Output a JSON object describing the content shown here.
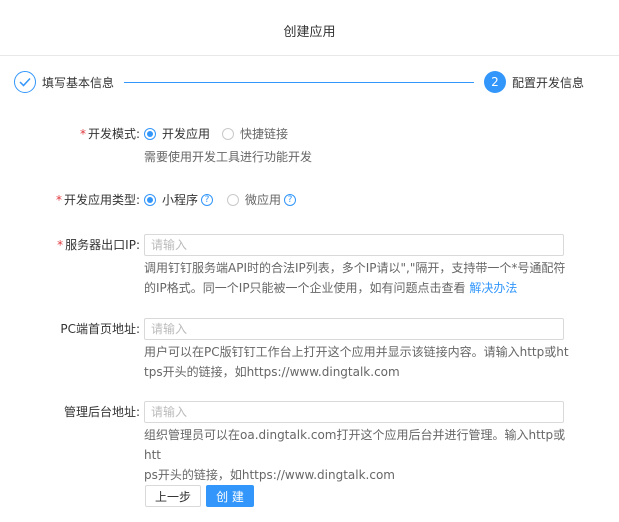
{
  "header": {
    "title": "创建应用"
  },
  "steps": [
    {
      "index": "✓",
      "label": "填写基本信息",
      "state": "done"
    },
    {
      "index": "2",
      "label": "配置开发信息",
      "state": "active"
    }
  ],
  "form": {
    "dev_mode": {
      "label": "开发模式:",
      "options": [
        "开发应用",
        "快捷链接"
      ],
      "selected": "开发应用",
      "help": "需要使用开发工具进行功能开发"
    },
    "app_type": {
      "label": "开发应用类型:",
      "options": [
        "小程序",
        "微应用"
      ],
      "selected": "小程序"
    },
    "server_ip": {
      "label": "服务器出口IP:",
      "placeholder": "请输入",
      "help_line1": "调用钉钉服务端API时的合法IP列表，多个IP请以\",\"隔开，支持带一个*号通配符",
      "help_line2": "的IP格式。同一个IP只能被一个企业使用，如有问题点击查看",
      "help_link": "解决办法"
    },
    "pc_home": {
      "label": "PC端首页地址:",
      "placeholder": "请输入",
      "help_line1": "用户可以在PC版钉钉工作台上打开这个应用并显示该链接内容。请输入http或ht",
      "help_line2": "tps开头的链接，如https://www.dingtalk.com"
    },
    "admin_url": {
      "label": "管理后台地址:",
      "placeholder": "请输入",
      "help_line1": "组织管理员可以在oa.dingtalk.com打开这个应用后台并进行管理。输入http或htt",
      "help_line2": "ps开头的链接，如https://www.dingtalk.com"
    }
  },
  "actions": {
    "prev_label": "上一步",
    "create_label": "创 建"
  },
  "colors": {
    "accent": "#3296fa",
    "required": "#e0393e"
  }
}
